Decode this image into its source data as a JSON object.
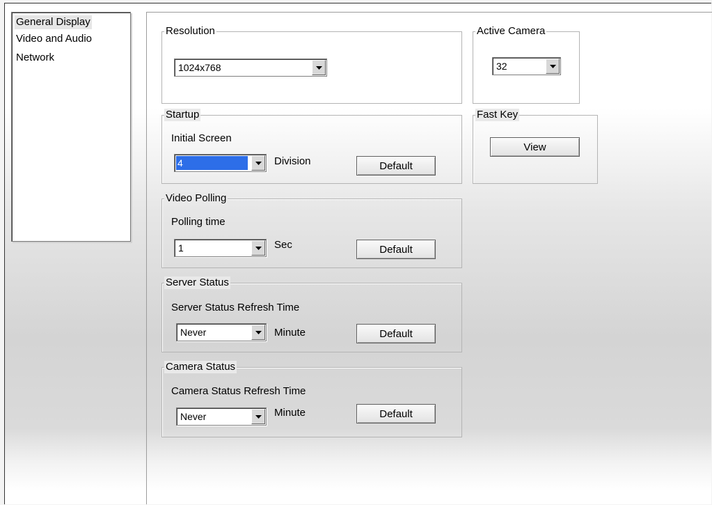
{
  "sidebar": {
    "items": [
      {
        "label": "General Display",
        "selected": true
      },
      {
        "label": "Video and Audio",
        "selected": false
      },
      {
        "label": "Network",
        "selected": false
      }
    ]
  },
  "resolution": {
    "legend": "Resolution",
    "value": "1024x768"
  },
  "active_camera": {
    "legend": "Active Camera",
    "value": "32"
  },
  "startup": {
    "legend": "Startup",
    "field_label": "Initial Screen",
    "value": "4",
    "unit": "Division",
    "default_label": "Default"
  },
  "fast_key": {
    "legend": "Fast Key",
    "view_label": "View"
  },
  "video_polling": {
    "legend": "Video Polling",
    "field_label": "Polling time",
    "value": "1",
    "unit": "Sec",
    "default_label": "Default"
  },
  "server_status": {
    "legend": "Server Status",
    "field_label": "Server Status Refresh Time",
    "value": "Never",
    "unit": "Minute",
    "default_label": "Default"
  },
  "camera_status": {
    "legend": "Camera Status",
    "field_label": "Camera Status Refresh Time",
    "value": "Never",
    "unit": "Minute",
    "default_label": "Default"
  },
  "colors": {
    "selection_highlight": "#2d6ee8",
    "sidebar_selected_bg": "#e6e6e6"
  }
}
